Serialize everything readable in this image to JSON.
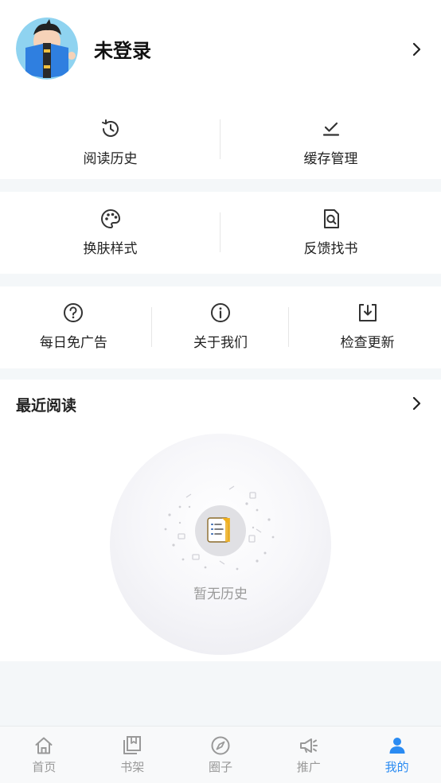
{
  "profile": {
    "username": "未登录"
  },
  "menu_row1": [
    {
      "label": "阅读历史",
      "icon": "history-icon"
    },
    {
      "label": "缓存管理",
      "icon": "download-check-icon"
    }
  ],
  "menu_row2": [
    {
      "label": "换肤样式",
      "icon": "palette-icon"
    },
    {
      "label": "反馈找书",
      "icon": "search-document-icon"
    }
  ],
  "menu_row3": [
    {
      "label": "每日免广告",
      "icon": "question-circle-icon"
    },
    {
      "label": "关于我们",
      "icon": "info-circle-icon"
    },
    {
      "label": "检查更新",
      "icon": "update-download-icon"
    }
  ],
  "recent": {
    "title": "最近阅读",
    "empty_text": "暂无历史"
  },
  "tabbar": {
    "active_color": "#2a8bf2",
    "inactive_color": "#999999",
    "items": [
      {
        "label": "首页",
        "icon": "home-icon"
      },
      {
        "label": "书架",
        "icon": "bookshelf-icon"
      },
      {
        "label": "圈子",
        "icon": "compass-icon"
      },
      {
        "label": "推广",
        "icon": "megaphone-icon"
      },
      {
        "label": "我的",
        "icon": "person-icon",
        "active": true
      }
    ]
  }
}
